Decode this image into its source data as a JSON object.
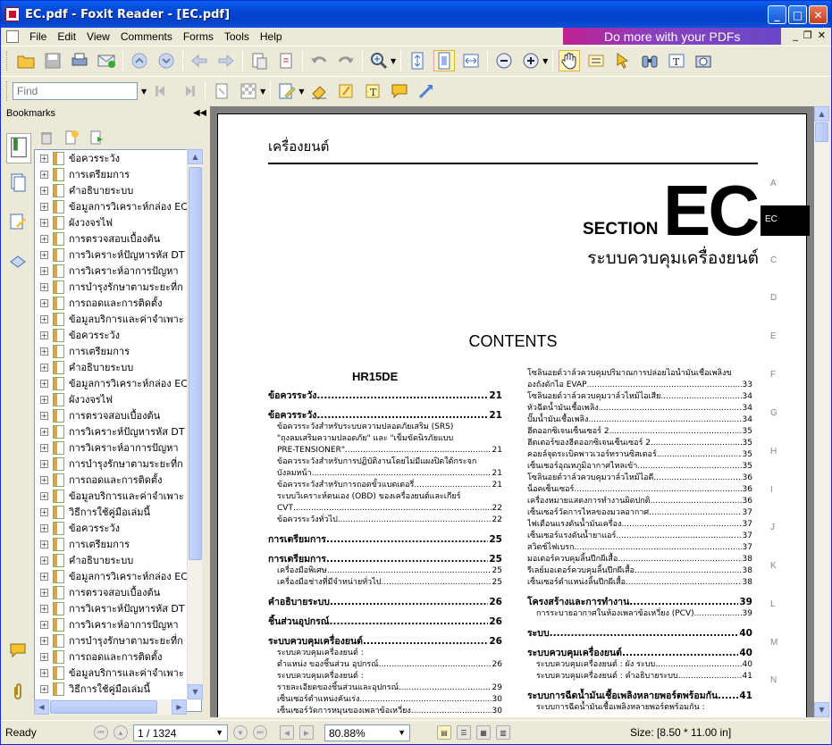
{
  "window": {
    "title": "EC.pdf - Foxit Reader - [EC.pdf]"
  },
  "menu": [
    "File",
    "Edit",
    "View",
    "Comments",
    "Forms",
    "Tools",
    "Help"
  ],
  "ad": {
    "text": "Do more with your PDFs"
  },
  "find": {
    "placeholder": "Find"
  },
  "sidebar": {
    "title": "Bookmarks",
    "items": [
      "ข้อควรระวัง",
      "การเตรียมการ",
      "คำอธิบายระบบ",
      "ข้อมูลการวิเคราะห์กล่อง EC",
      "ผังวงจรไฟ",
      "การตรวจสอบเบื้องต้น",
      "การวิเคราะห์ปัญหารหัส DT",
      "การวิเคราะห์อาการปัญหา",
      "การบำรุงรักษาตามระยะที่ก",
      "การถอดและการติดตั้ง",
      "ข้อมูลบริการและค่าจำเพาะ",
      "ข้อควรระวัง",
      "การเตรียมการ",
      "คำอธิบายระบบ",
      "ข้อมูลการวิเคราะห์กล่อง EC",
      "ผังวงจรไฟ",
      "การตรวจสอบเบื้องต้น",
      "การวิเคราะห์ปัญหารหัส DT",
      "การวิเคราะห์อาการปัญหา",
      "การบำรุงรักษาตามระยะที่ก",
      "การถอดและการติดตั้ง",
      "ข้อมูลบริการและค่าจำเพาะ",
      "วิธีการใช้คู่มือเล่มนี้",
      "ข้อควรระวัง",
      "การเตรียมการ",
      "คำอธิบายระบบ",
      "ข้อมูลการวิเคราะห์กล่อง EC",
      "การตรวจสอบเบื้องต้น",
      "การวิเคราะห์ปัญหารหัส DT",
      "การวิเคราะห์อาการปัญหา",
      "การบำรุงรักษาตามระยะที่ก",
      "การถอดและการติดตั้ง",
      "ข้อมูลบริการและค่าจำเพาะ",
      "วิธีการใช้คู่มือเล่มนี้"
    ]
  },
  "page": {
    "header": "เครื่องยนต์",
    "section_label": "SECTION",
    "section_code": "EC",
    "subtitle": "ระบบควบคุมเครื่องยนต์",
    "tab_label": "EC",
    "side_letters": [
      "A",
      "C",
      "D",
      "E",
      "F",
      "G",
      "H",
      "I",
      "J",
      "K",
      "L",
      "M",
      "N"
    ],
    "contents_title": "CONTENTS",
    "engine": "HR15DE",
    "left_toc": [
      {
        "type": "h",
        "t": "ข้อควรระวัง",
        "n": "21"
      },
      {
        "type": "h",
        "t": "ข้อควรระวัง",
        "n": "21"
      },
      {
        "type": "s",
        "t": "ข้อควรระวังสำหรับระบบความปลอดภัยเสริม (SRS)",
        "n": ""
      },
      {
        "type": "s",
        "t": "\"ถุงลมเสริมความปลอดภัย\" และ \"เข็มขัดนิรภัยแบบ",
        "n": ""
      },
      {
        "type": "s",
        "t": "PRE-TENSIONER\"",
        "n": "21"
      },
      {
        "type": "s",
        "t": "ข้อควรระวังสำหรับการปฏิบัติงานโดยไม่มีแผงปิดใต้กระจก",
        "n": ""
      },
      {
        "type": "s",
        "t": "บังลมหน้า",
        "n": "21"
      },
      {
        "type": "s",
        "t": "ข้อควรระวังสำหรับการถอดขั้วแบตเตอรี่",
        "n": "21"
      },
      {
        "type": "s",
        "t": "ระบบวิเคราะห์ตนเอง (OBD) ของเครื่องยนต์และเกียร์",
        "n": ""
      },
      {
        "type": "s",
        "t": "CVT",
        "n": "22"
      },
      {
        "type": "s",
        "t": "ข้อควรระวังทั่วไป",
        "n": "22"
      },
      {
        "type": "h",
        "t": "การเตรียมการ",
        "n": "25"
      },
      {
        "type": "h",
        "t": "การเตรียมการ",
        "n": "25"
      },
      {
        "type": "s",
        "t": "เครื่องมือพิเศษ",
        "n": "25"
      },
      {
        "type": "s",
        "t": "เครื่องมือช่างที่มีจำหน่ายทั่วไป",
        "n": "25"
      },
      {
        "type": "h",
        "t": "คำอธิบายระบบ",
        "n": "26"
      },
      {
        "type": "h",
        "t": "ชิ้นส่วนอุปกรณ์",
        "n": "26"
      },
      {
        "type": "h",
        "t": "ระบบควบคุมเครื่องยนต์",
        "n": "26"
      },
      {
        "type": "s",
        "t": "ระบบควบคุมเครื่องยนต์ :",
        "n": ""
      },
      {
        "type": "s",
        "t": "ตำแหน่ง ของชิ้นส่วน อุปกรณ์",
        "n": "26"
      },
      {
        "type": "s",
        "t": "ระบบควบคุมเครื่องยนต์ :",
        "n": ""
      },
      {
        "type": "s",
        "t": "รายละเอียดของชิ้นส่วนและอุปกรณ์",
        "n": "29"
      },
      {
        "type": "s",
        "t": "เซ็นเซอร์ตำแหน่งคันเร่ง",
        "n": "30"
      },
      {
        "type": "s",
        "t": "เซ็นเซอร์วัดการหมุนของเพลาข้อเหวี่ยง",
        "n": "30"
      }
    ],
    "right_toc": [
      {
        "type": "s0",
        "t": "โซลินอยด์วาล์วควบคุมปริมาณการปล่อยไอน้ำมันเชื้อเพลิงข",
        "n": ""
      },
      {
        "type": "s0",
        "t": "องถังดักไอ EVAP",
        "n": "33"
      },
      {
        "type": "s0",
        "t": "โซลินอยด์วาล์วควบคุมวาล์วไหม้ไอเสีย",
        "n": "34"
      },
      {
        "type": "s0",
        "t": "หัวฉีดน้ำมันเชื้อเพลิง",
        "n": "34"
      },
      {
        "type": "s0",
        "t": "ปั๊มน้ำมันเชื้อเพลิง",
        "n": "34"
      },
      {
        "type": "s0",
        "t": "ฮีตออกซิเจนเซ็นเซอร์ 2",
        "n": "35"
      },
      {
        "type": "s0",
        "t": "ฮีตเตอร์ของฮีตออกซิเจนเซ็นเซอร์ 2",
        "n": "35"
      },
      {
        "type": "s0",
        "t": "คอยล์จุดระเบิดพาวเวอร์ทรานซิสเตอร์",
        "n": "35"
      },
      {
        "type": "s0",
        "t": "เซ็นเซอร์อุณหภูมิอากาศไหลเข้า",
        "n": "35"
      },
      {
        "type": "s0",
        "t": "โซลินอยด์วาล์วควบคุมวาล์วไหม้ไอดี",
        "n": "36"
      },
      {
        "type": "s0",
        "t": "น็อคเซ็นเซอร์",
        "n": "36"
      },
      {
        "type": "s0",
        "t": "เครื่องหมายแสดงการทำงานผิดปกติ",
        "n": "36"
      },
      {
        "type": "s0",
        "t": "เซ็นเซอร์วัดการไหลของมวลอากาศ",
        "n": "37"
      },
      {
        "type": "s0",
        "t": "ไฟเตือนแรงดันน้ำมันเครื่อง",
        "n": "37"
      },
      {
        "type": "s0",
        "t": "เซ็นเซอร์แรงดันน้ำยาแอร์",
        "n": "37"
      },
      {
        "type": "s0",
        "t": "สวิตช์ไฟเบรก",
        "n": "37"
      },
      {
        "type": "s0",
        "t": "มอเตอร์ควบคุมลิ้นปีกผีเสื้อ",
        "n": "38"
      },
      {
        "type": "s0",
        "t": "รีเลย์มอเตอร์ควบคุมลิ้นปีกผีเสื้อ",
        "n": "38"
      },
      {
        "type": "s0",
        "t": "เซ็นเซอร์ตำแหน่งลิ้นปีกผีเสื้อ",
        "n": "38"
      },
      {
        "type": "h",
        "t": "โครงสร้างและการทำงาน",
        "n": "39"
      },
      {
        "type": "s",
        "t": "การระบายอากาศในห้องเพลาข้อเหวี่ยง (PCV)",
        "n": "39"
      },
      {
        "type": "h",
        "t": "ระบบ",
        "n": "40"
      },
      {
        "type": "h",
        "t": "ระบบควบคุมเครื่องยนต์",
        "n": "40"
      },
      {
        "type": "s",
        "t": "ระบบควบคุมเครื่องยนต์ : ผัง ระบบ",
        "n": "40"
      },
      {
        "type": "s",
        "t": "ระบบควบคุมเครื่องยนต์ : คำอธิบายระบบ",
        "n": "41"
      },
      {
        "type": "h",
        "t": "ระบบการฉีดน้ำมันเชื้อเพลิงหลายพอร์ตพร้อมกัน",
        "n": "41"
      },
      {
        "type": "s",
        "t": "ระบบการฉีดน้ำมันเชื้อเพลิงหลายพอร์ตพร้อมกัน :",
        "n": ""
      }
    ]
  },
  "status": {
    "ready": "Ready",
    "page_value": "1 / 1324",
    "zoom_value": "80.88%",
    "size_label": "Size: [8.50 * 11.00 in]"
  },
  "colors": {
    "title_bar": "#0A5FEA",
    "ad_banner": "#C02090",
    "accent_black": "#000000"
  }
}
